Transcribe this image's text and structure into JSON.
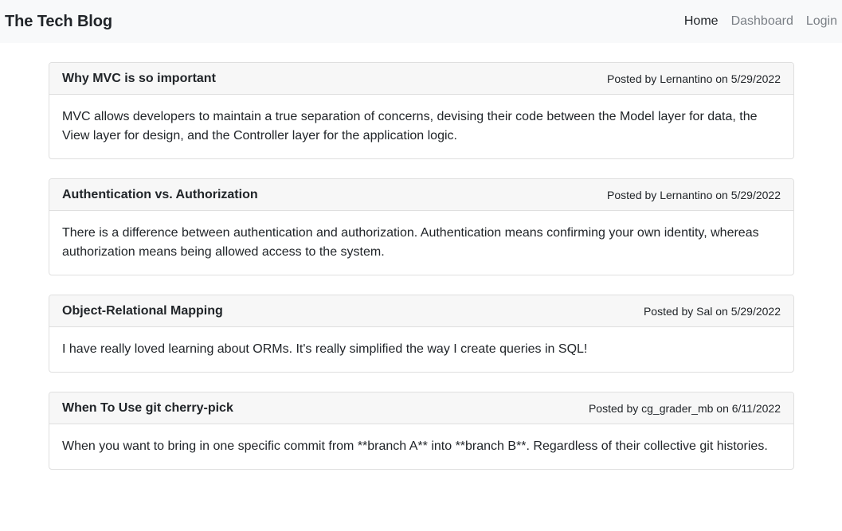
{
  "navbar": {
    "brand": "The Tech Blog",
    "links": [
      {
        "label": "Home"
      },
      {
        "label": "Dashboard"
      },
      {
        "label": "Login"
      }
    ]
  },
  "posts": [
    {
      "title": "Why MVC is so important",
      "meta": "Posted by Lernantino on 5/29/2022",
      "body": "MVC allows developers to maintain a true separation of concerns, devising their code between the Model layer for data, the View layer for design, and the Controller layer for the application logic."
    },
    {
      "title": "Authentication vs. Authorization",
      "meta": "Posted by Lernantino on 5/29/2022",
      "body": "There is a difference between authentication and authorization. Authentication means confirming your own identity, whereas authorization means being allowed access to the system."
    },
    {
      "title": "Object-Relational Mapping",
      "meta": "Posted by Sal on 5/29/2022",
      "body": "I have really loved learning about ORMs. It's really simplified the way I create queries in SQL!"
    },
    {
      "title": "When To Use git cherry-pick",
      "meta": "Posted by cg_grader_mb on 6/11/2022",
      "body": "When you want to bring in one specific commit from **branch A** into **branch B**. Regardless of their collective git histories."
    }
  ]
}
